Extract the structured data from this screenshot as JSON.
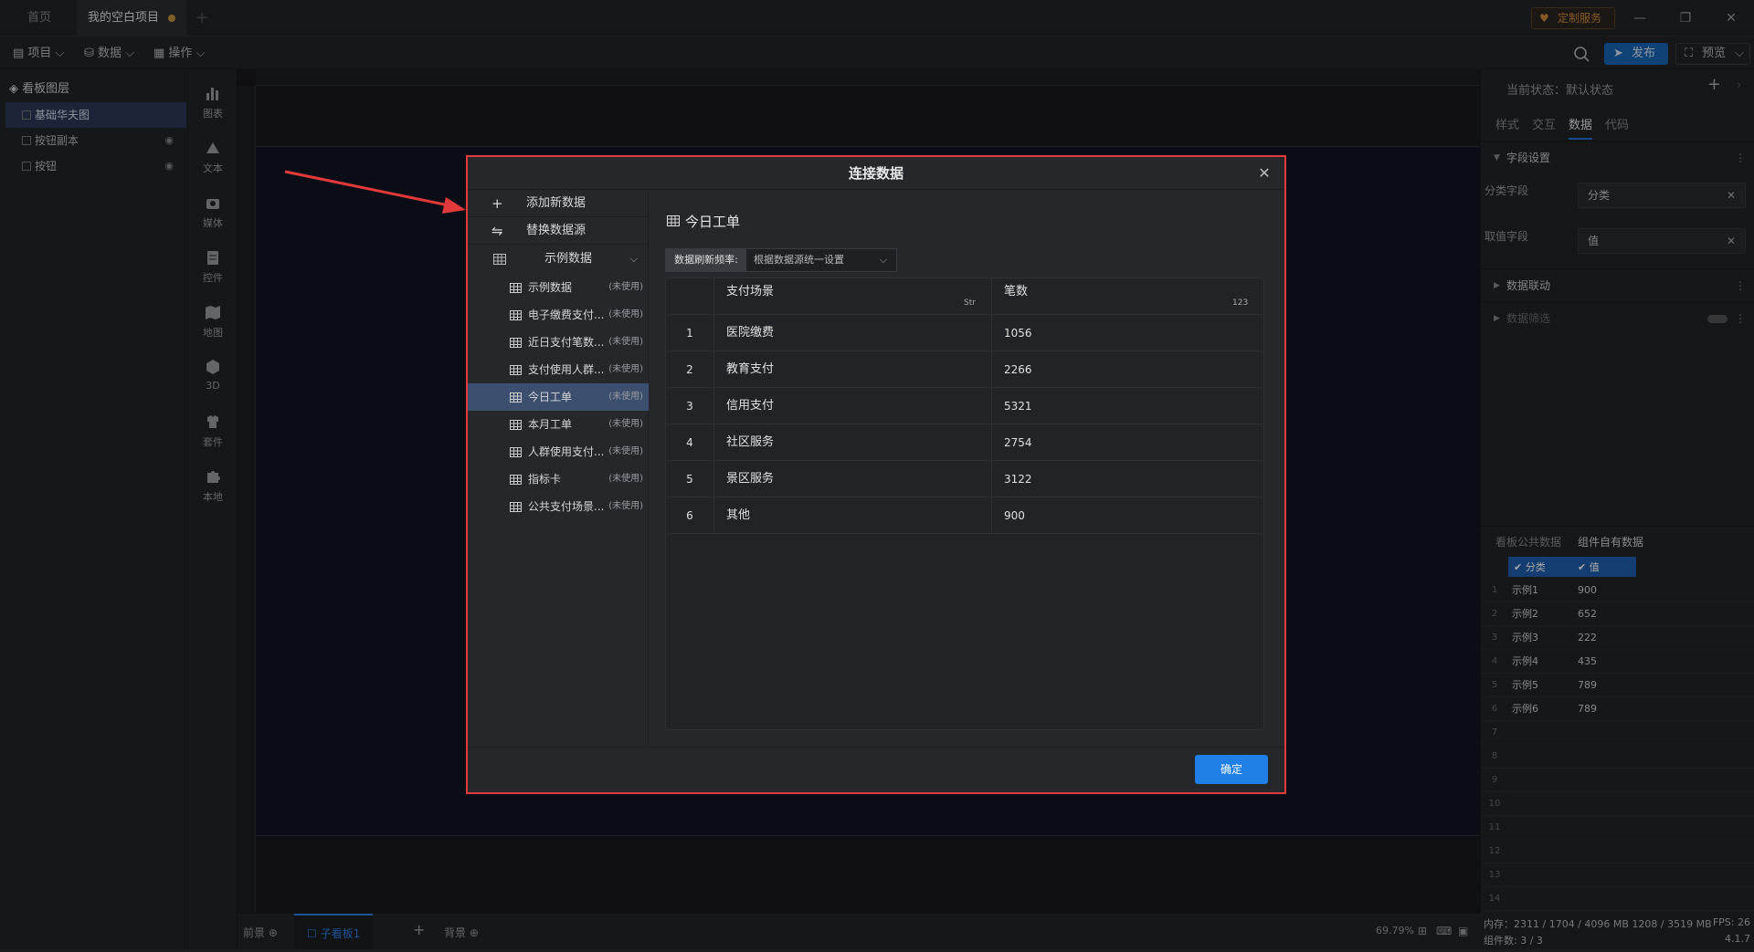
{
  "titlebar": {
    "tab_home": "首页",
    "tab_project": "我的空白项目",
    "custom_service": "定制服务"
  },
  "toolbar": {
    "menu_project": "项目",
    "menu_data": "数据",
    "menu_action": "操作",
    "publish": "发布",
    "preview": "预览"
  },
  "layers": {
    "title": "看板图层",
    "items": [
      {
        "label": "基础华夫图"
      },
      {
        "label": "按钮副本"
      },
      {
        "label": "按钮"
      }
    ]
  },
  "tools": [
    {
      "label": "图表",
      "icon": "chart-icon"
    },
    {
      "label": "文本",
      "icon": "text-icon"
    },
    {
      "label": "媒体",
      "icon": "media-icon"
    },
    {
      "label": "控件",
      "icon": "control-icon"
    },
    {
      "label": "地图",
      "icon": "map-icon"
    },
    {
      "label": "3D",
      "icon": "cube-icon"
    },
    {
      "label": "套件",
      "icon": "kit-icon"
    },
    {
      "label": "本地",
      "icon": "puzzle-icon"
    }
  ],
  "bottombar": {
    "tab_front": "前景",
    "tab_sub": "子看板1",
    "tab_back": "背景",
    "zoom": "69.79%"
  },
  "status": {
    "memory": "内存：2311 / 1704 / 4096 MB  1208 / 3519 MB",
    "fps": "FPS: 26",
    "components": "组件数: 3 / 3",
    "version": "4.1.7"
  },
  "rightpanel": {
    "state": "当前状态：默认状态",
    "tabs": [
      "样式",
      "交互",
      "数据",
      "代码"
    ],
    "section_fields": "字段设置",
    "label_category": "分类字段",
    "value_category": "分类",
    "label_value": "取值字段",
    "value_value": "值",
    "section_linkage": "数据联动",
    "section_filter": "数据筛选",
    "data_tab_public": "看板公共数据",
    "data_tab_own": "组件自有数据",
    "grid_headers": [
      "分类",
      "值"
    ],
    "grid_rows": [
      {
        "c1": "示例1",
        "c2": "900"
      },
      {
        "c1": "示例2",
        "c2": "652"
      },
      {
        "c1": "示例3",
        "c2": "222"
      },
      {
        "c1": "示例4",
        "c2": "435"
      },
      {
        "c1": "示例5",
        "c2": "789"
      },
      {
        "c1": "示例6",
        "c2": "789"
      }
    ],
    "row_numbers": [
      "1",
      "2",
      "3",
      "4",
      "5",
      "6",
      "7",
      "8",
      "9",
      "10",
      "11",
      "12",
      "13",
      "14"
    ]
  },
  "dialog": {
    "title": "连接数据",
    "add_new": "添加新数据",
    "replace_source": "替换数据源",
    "group": "示例数据",
    "items": [
      {
        "label": "示例数据",
        "tag": "(未使用)"
      },
      {
        "label": "电子缴费支付...",
        "tag": "(未使用)"
      },
      {
        "label": "近日支付笔数...",
        "tag": "(未使用)"
      },
      {
        "label": "支付使用人群...",
        "tag": "(未使用)"
      },
      {
        "label": "今日工单",
        "tag": "(未使用)"
      },
      {
        "label": "本月工单",
        "tag": "(未使用)"
      },
      {
        "label": "人群使用支付...",
        "tag": "(未使用)"
      },
      {
        "label": "指标卡",
        "tag": "(未使用)"
      },
      {
        "label": "公共支付场景...",
        "tag": "(未使用)"
      }
    ],
    "main_title": "今日工单",
    "refresh_label": "数据刷新频率:",
    "refresh_value": "根据数据源统一设置",
    "table_headers": [
      "支付场景",
      "笔数"
    ],
    "table_rows": [
      {
        "idx": "1",
        "a": "医院缴费",
        "b": "1056"
      },
      {
        "idx": "2",
        "a": "教育支付",
        "b": "2266"
      },
      {
        "idx": "3",
        "a": "信用支付",
        "b": "5321"
      },
      {
        "idx": "4",
        "a": "社区服务",
        "b": "2754"
      },
      {
        "idx": "5",
        "a": "景区服务",
        "b": "3122"
      },
      {
        "idx": "6",
        "a": "其他",
        "b": "900"
      }
    ],
    "confirm": "确定"
  },
  "colors": {
    "accent": "#1e7fe6",
    "highlight": "#e23a3a"
  }
}
